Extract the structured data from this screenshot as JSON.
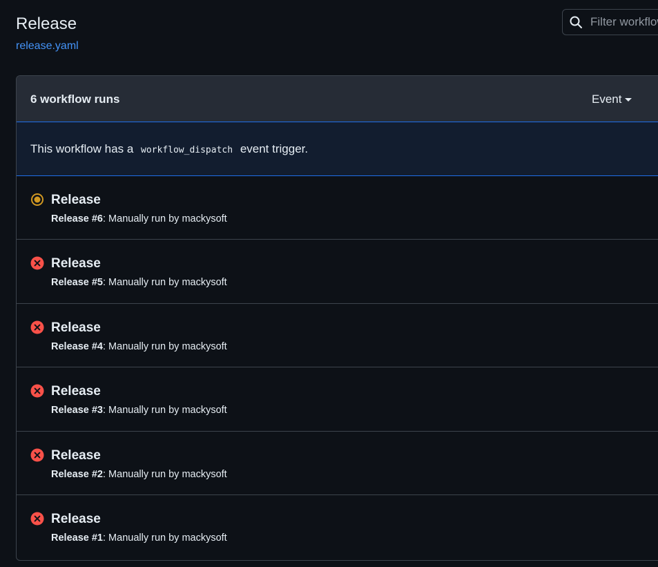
{
  "header": {
    "title": "Release",
    "file_link": "release.yaml"
  },
  "filter": {
    "placeholder": "Filter workflow runs"
  },
  "box": {
    "runs_count": "6 workflow runs",
    "event_label": "Event",
    "dispatch_prefix": "This workflow has a",
    "dispatch_code": "workflow_dispatch",
    "dispatch_suffix": "event trigger."
  },
  "runs": [
    {
      "title": "Release",
      "workflow": "Release",
      "number": "#6",
      "meta": ": Manually run by mackysoft",
      "status": "in_progress",
      "status_icon": "in-progress-icon"
    },
    {
      "title": "Release",
      "workflow": "Release",
      "number": "#5",
      "meta": ": Manually run by mackysoft",
      "status": "failure",
      "status_icon": "x-circle-icon"
    },
    {
      "title": "Release",
      "workflow": "Release",
      "number": "#4",
      "meta": ": Manually run by mackysoft",
      "status": "failure",
      "status_icon": "x-circle-icon"
    },
    {
      "title": "Release",
      "workflow": "Release",
      "number": "#3",
      "meta": ": Manually run by mackysoft",
      "status": "failure",
      "status_icon": "x-circle-icon"
    },
    {
      "title": "Release",
      "workflow": "Release",
      "number": "#2",
      "meta": ": Manually run by mackysoft",
      "status": "failure",
      "status_icon": "x-circle-icon"
    },
    {
      "title": "Release",
      "workflow": "Release",
      "number": "#1",
      "meta": ": Manually run by mackysoft",
      "status": "failure",
      "status_icon": "x-circle-icon"
    }
  ],
  "colors": {
    "in_progress": "#d29922",
    "failure": "#f85149",
    "link": "#4493f8"
  }
}
